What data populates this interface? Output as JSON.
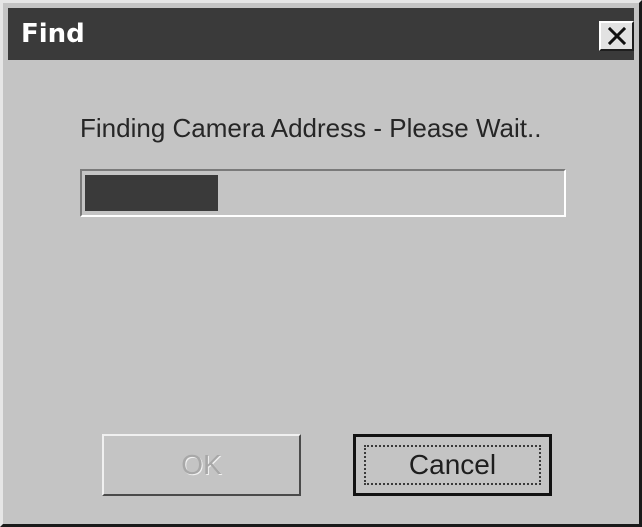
{
  "window": {
    "title": "Find"
  },
  "icons": {
    "close": "close-icon"
  },
  "status": {
    "message": "Finding Camera Address - Please Wait.."
  },
  "progress": {
    "value_percent": 28
  },
  "buttons": {
    "ok_label": "OK",
    "ok_enabled": false,
    "cancel_label": "Cancel"
  },
  "colors": {
    "titlebar": "#3a3a3a",
    "window_bg": "#c4c4c4",
    "progress_fill": "#3a3a3a"
  }
}
